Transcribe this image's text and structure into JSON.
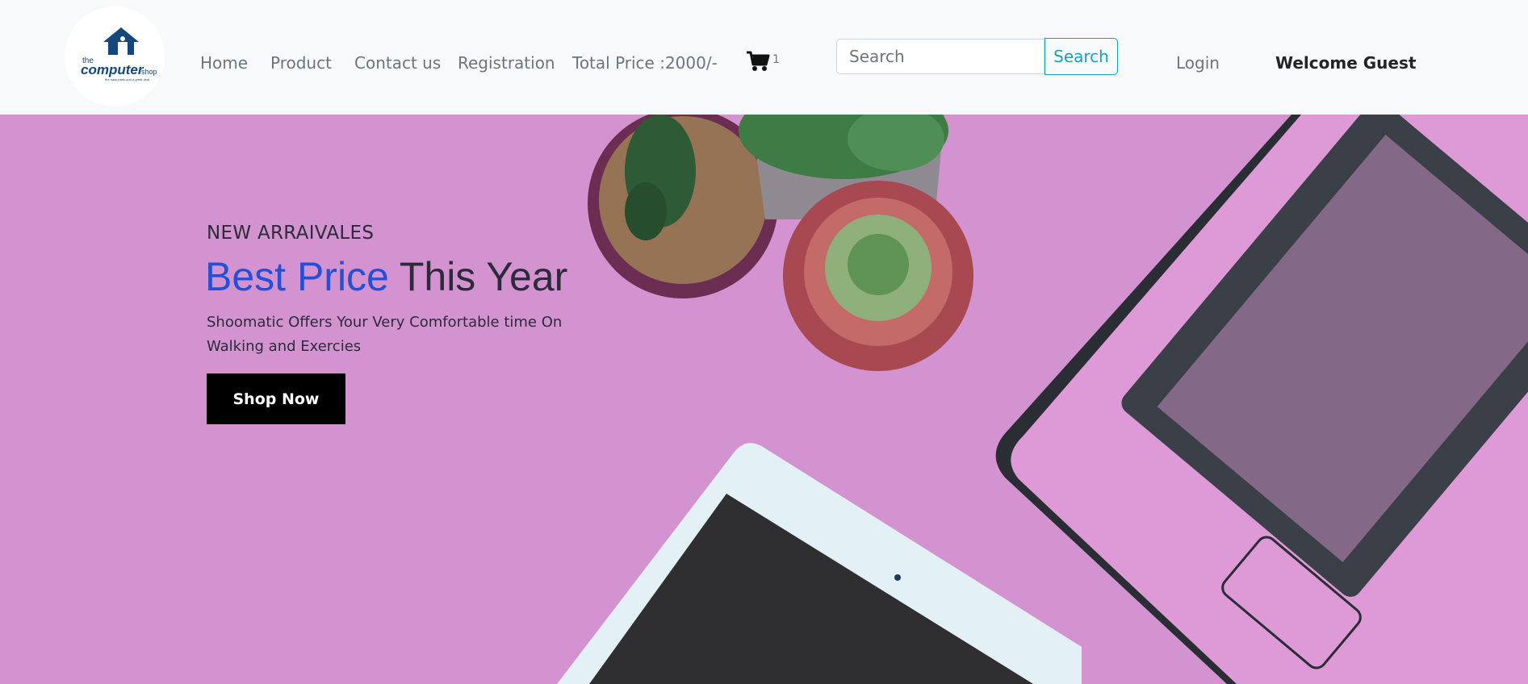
{
  "brand": {
    "logo_alt": "the computer shop",
    "logo_text_top": "the",
    "logo_text_main": "computer",
    "logo_text_suffix": "shop",
    "logo_tagline": "the easy parts and a great deal"
  },
  "nav": {
    "items": [
      {
        "label": "Home"
      },
      {
        "label": "Product"
      },
      {
        "label": "Contact us"
      },
      {
        "label": "Registration"
      },
      {
        "label": "Total Price :2000/-"
      }
    ],
    "cart": {
      "icon": "cart-icon",
      "count": "1"
    },
    "search": {
      "placeholder": "Search",
      "value": "",
      "button_label": "Search"
    },
    "login_label": "Login",
    "welcome_text": "Welcome Guest"
  },
  "hero": {
    "eyebrow": "NEW ARRAIVALES",
    "title_accent": "Best Price",
    "title_rest": " This Year",
    "description": "Shoomatic Offers Your Very Comfortable time On Walking and Exercies",
    "cta_label": "Shop Now"
  },
  "colors": {
    "accent_blue": "#2450d8",
    "info_teal": "#17a2b8",
    "hero_background": "#d393d1",
    "navbar_background": "#f8f9fa",
    "cta_background": "#000000"
  }
}
